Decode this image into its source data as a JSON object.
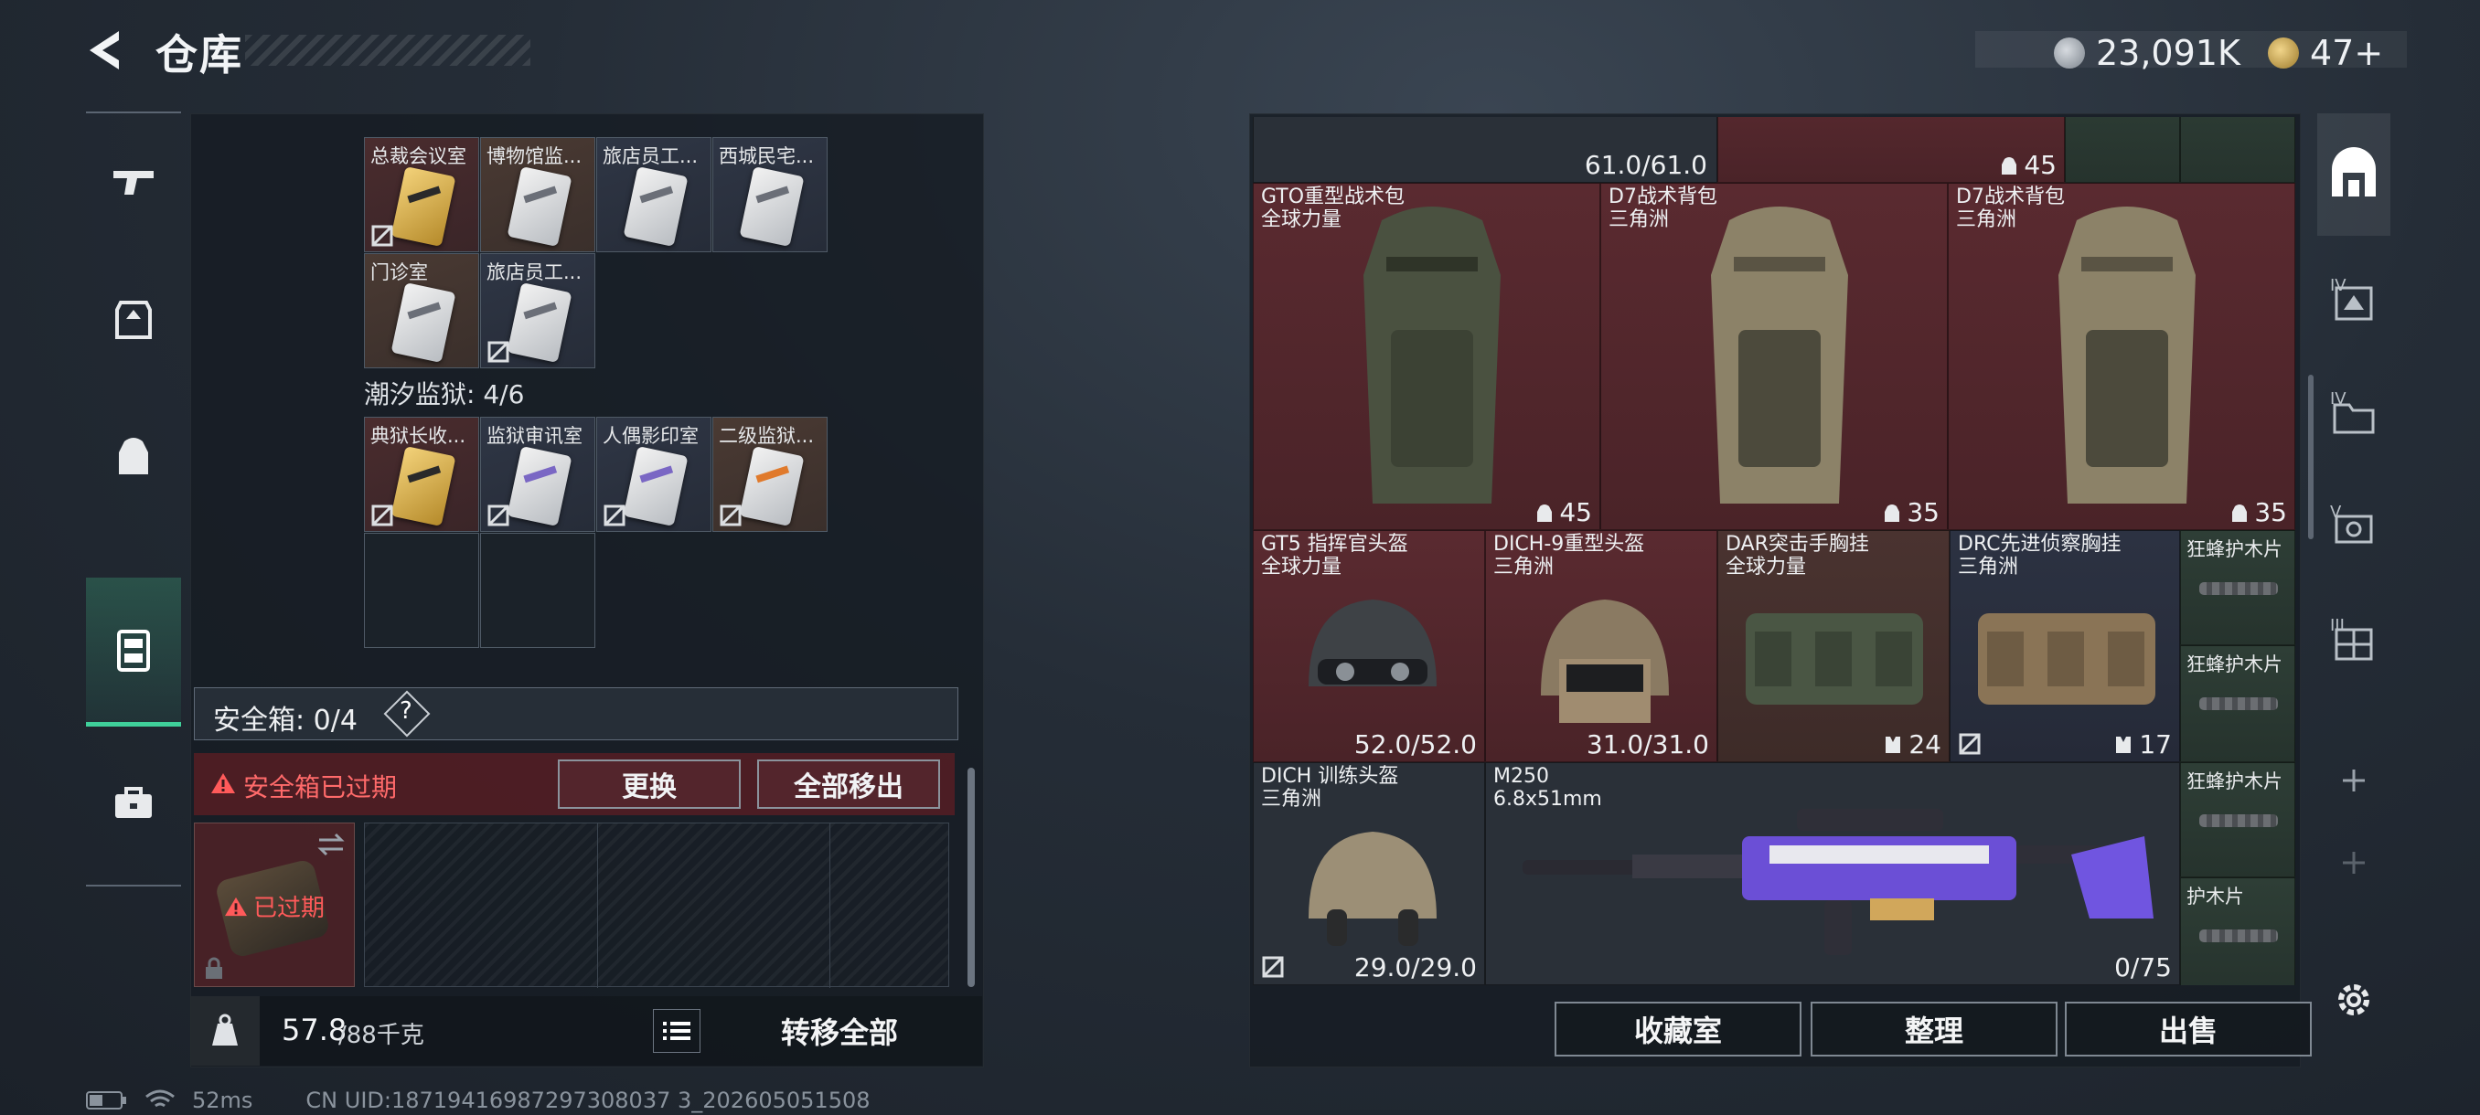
{
  "header": {
    "title": "仓库",
    "currency_1": "23,091K",
    "currency_2": "47+"
  },
  "left_panel": {
    "top_row": [
      {
        "label": "总裁会议室",
        "card": "gold"
      },
      {
        "label": "博物馆监...",
        "card": "white"
      },
      {
        "label": "旅店员工...",
        "card": "white"
      },
      {
        "label": "西城民宅...",
        "card": "white"
      }
    ],
    "second_row": [
      {
        "label": "门诊室",
        "card": "white"
      },
      {
        "label": "旅店员工...",
        "card": "white"
      }
    ],
    "section_2_title": "潮汐监狱: 4/6",
    "prison_row": [
      {
        "label": "典狱长收...",
        "card": "gold"
      },
      {
        "label": "监狱审讯室",
        "card": "purple"
      },
      {
        "label": "人偶影印室",
        "card": "purple"
      },
      {
        "label": "二级监狱...",
        "card": "orange"
      }
    ],
    "safebox_label": "安全箱: 0/4",
    "safebox_help": "?",
    "expired_warning": "安全箱已过期",
    "replace_button": "更换",
    "remove_all_button": "全部移出",
    "expired_badge": "已过期",
    "weight_value": "57.8",
    "weight_max": "/88千克",
    "transfer_all_button": "转移全部"
  },
  "right_panel": {
    "top_partial": {
      "value_1": "61.0/61.0",
      "value_2": "45"
    },
    "backpacks": [
      {
        "name": "GTO重型战术包",
        "sub": "全球力量",
        "value": "45"
      },
      {
        "name": "D7战术背包",
        "sub": "三角洲",
        "value": "35"
      },
      {
        "name": "D7战术背包",
        "sub": "三角洲",
        "value": "35"
      }
    ],
    "gear_row": [
      {
        "name": "GT5 指挥官头盔",
        "sub": "全球力量",
        "value": "52.0/52.0"
      },
      {
        "name": "DICH-9重型头盔",
        "sub": "三角洲",
        "value": "31.0/31.0"
      },
      {
        "name": "DAR突击手胸挂",
        "sub": "全球力量",
        "value": "24"
      },
      {
        "name": "DRC先进侦察胸挂",
        "sub": "三角洲",
        "value": "17"
      }
    ],
    "plates": [
      "狂蜂护木片",
      "狂蜂护木片",
      "狂蜂护木片",
      "护木片"
    ],
    "helmet_3": {
      "name": "DICH 训练头盔",
      "sub": "三角洲",
      "value": "29.0/29.0"
    },
    "weapon": {
      "name": "M250",
      "sub": "6.8x51mm",
      "value": "0/75"
    },
    "buttons": {
      "collection": "收藏室",
      "organize": "整理",
      "sell": "出售"
    }
  },
  "right_strip": [
    "IV",
    "IV",
    "V",
    "III"
  ],
  "status_bar": {
    "ping": "52ms",
    "uid": "CN UID:18719416987297308037 3_202605051508"
  },
  "colors": {
    "accent": "#3fd09a",
    "expired_red": "#e04848"
  }
}
